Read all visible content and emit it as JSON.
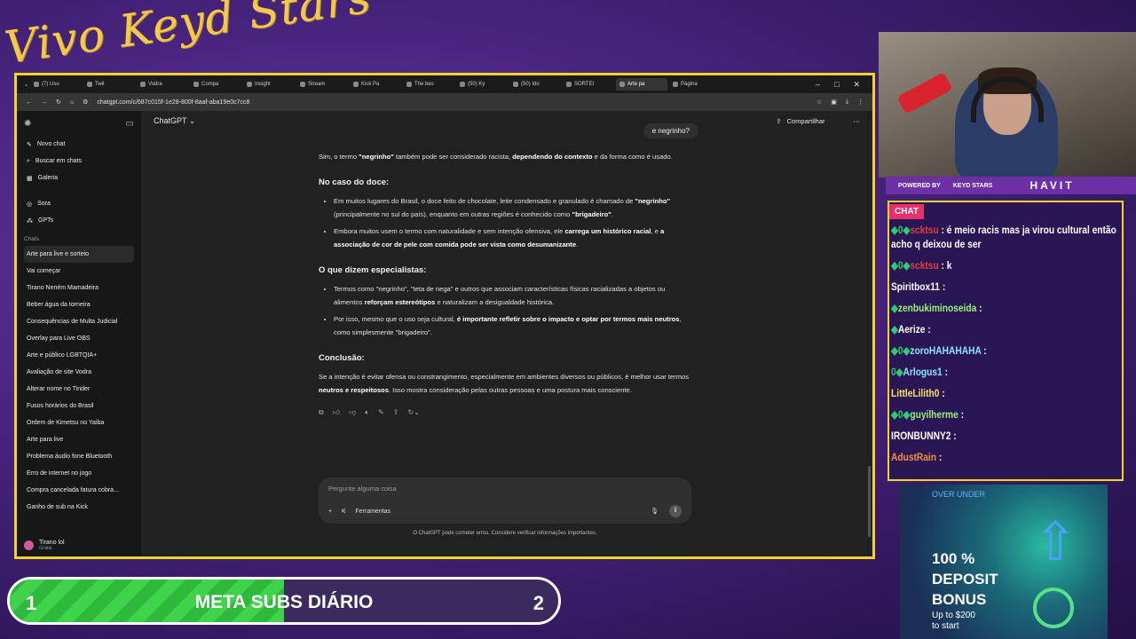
{
  "overlay": {
    "logo_text": "Vivo Keyd Stars",
    "powered_by": "POWERED BY",
    "powered_brand": "KEYD STARS",
    "sponsor": "HAVIT",
    "chat_tag": "CHAT",
    "meta": {
      "left": "1",
      "title": "META SUBS DIÁRIO",
      "right": "2",
      "progress": 0.5
    },
    "ad": {
      "brand": "OVER UNDER",
      "title": "100 % DEPOSIT BONUS",
      "sub1": "Up to $200",
      "sub2": "to start"
    }
  },
  "chat": [
    {
      "badges": "◆0◆",
      "user": "scktsu",
      "color": "red",
      "text": ": é meio racis mas ja virou cultural então acho q deixou de ser"
    },
    {
      "badges": "◆0◆",
      "user": "scktsu",
      "color": "red",
      "text": ": k"
    },
    {
      "badges": "",
      "user": "Spiritbox11",
      "color": "white",
      "text": ":"
    },
    {
      "badges": "◆",
      "user": "zenbukiminoseida",
      "color": "green",
      "text": ":"
    },
    {
      "badges": "◆",
      "user": "Aerize",
      "color": "white",
      "text": ":"
    },
    {
      "badges": "◆0◆",
      "user": "zoroHAHAHAHA",
      "color": "blue",
      "text": ":"
    },
    {
      "badges": "0◆",
      "user": "Arlogus1",
      "color": "blue",
      "text": ":"
    },
    {
      "badges": "",
      "user": "LittleLilith0",
      "color": "yellow",
      "text": ":"
    },
    {
      "badges": "◆0◆",
      "user": "guyilherme",
      "color": "green",
      "text": ":"
    },
    {
      "badges": "",
      "user": "IRONBUNNY2",
      "color": "white",
      "text": ":"
    },
    {
      "badges": "",
      "user": "AdustRain",
      "color": "orange",
      "text": ":"
    }
  ],
  "browser": {
    "tabs": [
      "(7) Usu",
      "Twit",
      "Vodra",
      "Compa",
      "Insight",
      "Stream",
      "Kick Pa",
      "The bes",
      "(50) Ky",
      "(50) Ido",
      "SORTEI",
      "Arte pa",
      "Página"
    ],
    "active_tab": 11,
    "url": "chatgpt.com/c/687c015f-1e28-800f-8aaf-aba19e0c7cc8"
  },
  "sidebar": {
    "items": [
      "Novo chat",
      "Buscar em chats",
      "Galeria"
    ],
    "items2": [
      "Sora",
      "GPTs"
    ],
    "chats_label": "Chats",
    "chats": [
      "Arte para live e sorteio",
      "Vai começar",
      "Tirano Neném Mamadeira",
      "Beber água da torneira",
      "Consequências de Multa Judicial",
      "Overlay para Live OBS",
      "Arte e público LGBTQIA+",
      "Avaliação de site Vodra",
      "Alterar nome no Tinder",
      "Fusos horários do Brasil",
      "Ordem de Kimetsu no Yaiba",
      "Arte para live",
      "Problema áudio fone Bluetooth",
      "Erro de internet no jogo",
      "Compra cancelada fatura cobra...",
      "Ganho de sub na Kick"
    ],
    "user_name": "Tirano lol",
    "user_plan": "Grátis"
  },
  "main": {
    "model": "ChatGPT ⌄",
    "share": "Compartilhar",
    "user_message": "e negrinho?",
    "intro_1": "Sim, o termo ",
    "intro_b1": "\"negrinho\"",
    "intro_2": " também pode ser considerado racista, ",
    "intro_b2": "dependendo do contexto",
    "intro_3": " e da forma como é usado.",
    "h1": "No caso do doce:",
    "b1_1": "Em muitos lugares do Brasil, o doce feito de chocolate, leite condensado e granulado é chamado de ",
    "b1_b1": "\"negrinho\"",
    "b1_2": " (principalmente no sul do país), enquanto em outras regiões é conhecido como ",
    "b1_b2": "\"brigadeiro\"",
    "b1_3": ".",
    "b2_1": "Embora muitos usem o termo com naturalidade e sem intenção ofensiva, ele ",
    "b2_b1": "carrega um histórico racial",
    "b2_2": ", e ",
    "b2_b2": "a associação de cor de pele com comida pode ser vista como desumanizante",
    "b2_3": ".",
    "h2": "O que dizem especialistas:",
    "b3_1": "Termos como \"negrinho\", \"teta de nega\" e outros que associam características físicas racializadas a objetos ou alimentos ",
    "b3_b1": "reforçam estereótipos",
    "b3_2": " e naturalizam a desigualdade histórica.",
    "b4_1": "Por isso, mesmo que o uso seja cultural, ",
    "b4_b1": "é importante refletir sobre o impacto e optar por termos mais neutros",
    "b4_2": ", como simplesmente \"brigadeiro\".",
    "h3": "Conclusão:",
    "c_1": "Se a intenção é evitar ofensa ou constrangimento, especialmente em ambientes diversos ou públicos, é melhor usar termos ",
    "c_b1": "neutros e respeitosos",
    "c_2": ". Isso mostra consideração pelas outras pessoas e uma postura mais consciente.",
    "composer_placeholder": "Pergunte alguma coisa",
    "tools": "Ferramentas",
    "disclaimer": "O ChatGPT pode cometer erros. Considere verificar informações importantes."
  }
}
